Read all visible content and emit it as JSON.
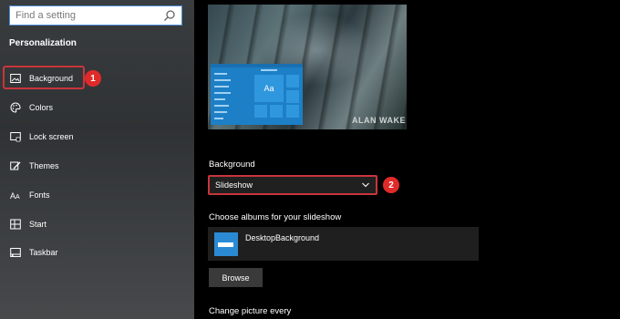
{
  "search": {
    "placeholder": "Find a setting",
    "icon": "search-icon"
  },
  "sidebar": {
    "section_title": "Personalization",
    "items": [
      {
        "label": "Background",
        "icon": "picture-icon"
      },
      {
        "label": "Colors",
        "icon": "palette-icon"
      },
      {
        "label": "Lock screen",
        "icon": "lock-screen-icon"
      },
      {
        "label": "Themes",
        "icon": "brush-icon"
      },
      {
        "label": "Fonts",
        "icon": "font-icon"
      },
      {
        "label": "Start",
        "icon": "start-grid-icon"
      },
      {
        "label": "Taskbar",
        "icon": "taskbar-icon"
      }
    ]
  },
  "annotations": {
    "step1": "1",
    "step2": "2",
    "highlight_color": "#c8353c",
    "badge_color": "#e02a2a"
  },
  "preview": {
    "tile_text": "Aa",
    "logo_text": "ALAN WAKE"
  },
  "main": {
    "background_label": "Background",
    "background_value": "Slideshow",
    "albums_label": "Choose albums for your slideshow",
    "album_name": "DesktopBackground",
    "browse_label": "Browse",
    "change_picture_label": "Change picture every"
  },
  "colors": {
    "accent": "#1d7fc6",
    "tile": "#2f97dd",
    "card": "#1f1f1f"
  }
}
